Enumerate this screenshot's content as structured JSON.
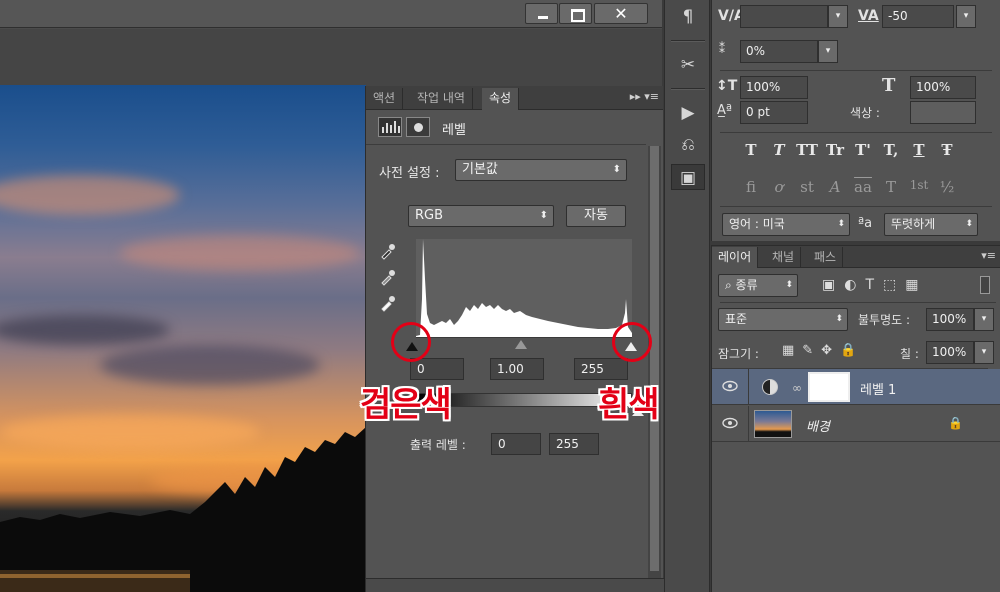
{
  "properties_panel": {
    "tabs": [
      "액션",
      "작업 내역",
      "속성"
    ],
    "title": "레벨",
    "preset_label": "사전 설정 :",
    "preset_value": "기본값",
    "channel_value": "RGB",
    "auto_button": "자동",
    "input_black": "0",
    "input_mid": "1.00",
    "input_white": "255",
    "output_label": "출력 레벨 :",
    "output_black": "0",
    "output_white": "255"
  },
  "annotations": {
    "black_label": "검은색",
    "white_label": "흰색",
    "accent_color": "#e30016"
  },
  "character_panel": {
    "kerning_value": "-50",
    "scale_pct": "0%",
    "vertical_scale": "100%",
    "horizontal_scale": "100%",
    "baseline_shift": "0 pt",
    "color_label": "색상 :",
    "language": "영어 : 미국",
    "aa_symbol": "ªa",
    "antialias": "뚜렷하게",
    "type_styles": [
      "T",
      "T",
      "TT",
      "Tr",
      "T'",
      "T,",
      "T",
      "Ŧ"
    ],
    "opentype_styles": [
      "fi",
      "ơ",
      "st",
      "A",
      "aa",
      "T",
      "1st",
      "½"
    ]
  },
  "layers_panel": {
    "tabs": [
      "레이어",
      "채널",
      "패스"
    ],
    "filter_kind": "종류",
    "blend_mode": "표준",
    "opacity_label": "불투명도 :",
    "opacity_value": "100%",
    "lock_label": "잠그기 :",
    "fill_label": "칠 :",
    "fill_value": "100%",
    "layers": [
      {
        "name": "레벨 1"
      },
      {
        "name": "배경"
      }
    ]
  },
  "window": {
    "close_glyph": "✕"
  }
}
